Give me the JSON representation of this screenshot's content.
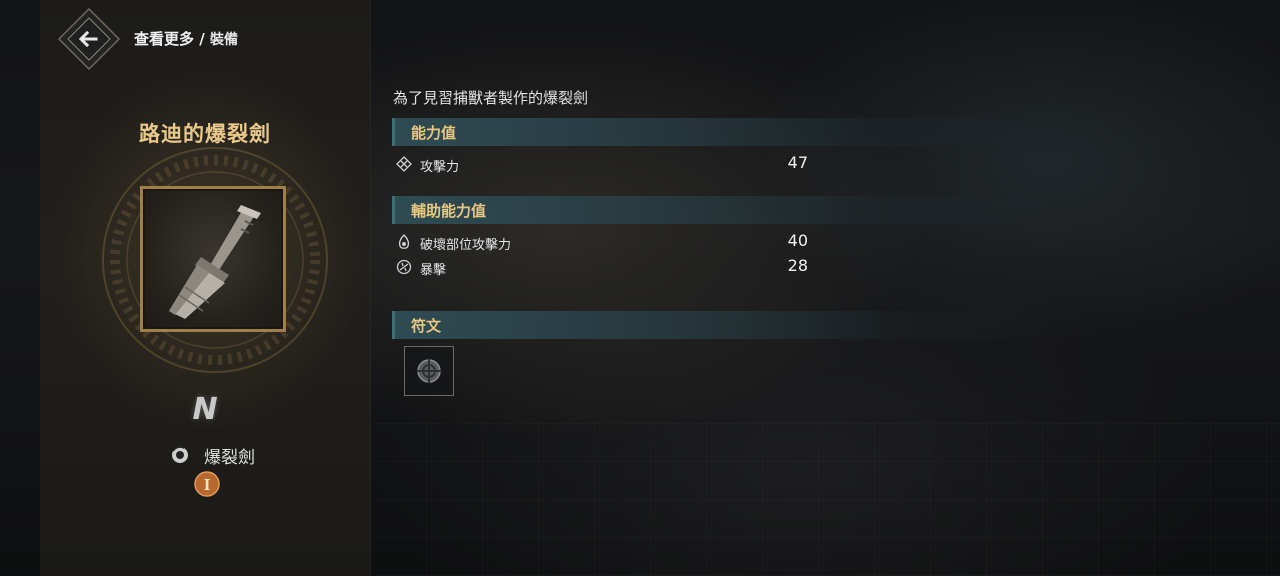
{
  "header": {
    "breadcrumb_main": "查看更多",
    "breadcrumb_sep": " / ",
    "breadcrumb_sub": "裝備"
  },
  "item": {
    "name": "路迪的爆裂劍",
    "rank": "N",
    "weapon_type": "爆裂劍",
    "tier": "I",
    "icon": "burst-sword-icon"
  },
  "details": {
    "description": "為了見習捕獸者製作的爆裂劍",
    "sections": {
      "stats": {
        "title": "能力值",
        "rows": [
          {
            "label": "攻擊力",
            "value": "47",
            "icon": "attack-icon"
          }
        ]
      },
      "sub_stats": {
        "title": "輔助能力值",
        "rows": [
          {
            "label": "破壞部位攻擊力",
            "value": "40",
            "icon": "part-break-icon"
          },
          {
            "label": "暴擊",
            "value": "28",
            "icon": "critical-icon"
          }
        ]
      },
      "runes": {
        "title": "符文",
        "slots": [
          {
            "state": "empty",
            "icon": "rune-slot-icon"
          }
        ]
      }
    }
  },
  "colors": {
    "accent_gold": "#e9c77f",
    "header_teal": "#304e56",
    "frame_bronze": "#a0804a"
  }
}
